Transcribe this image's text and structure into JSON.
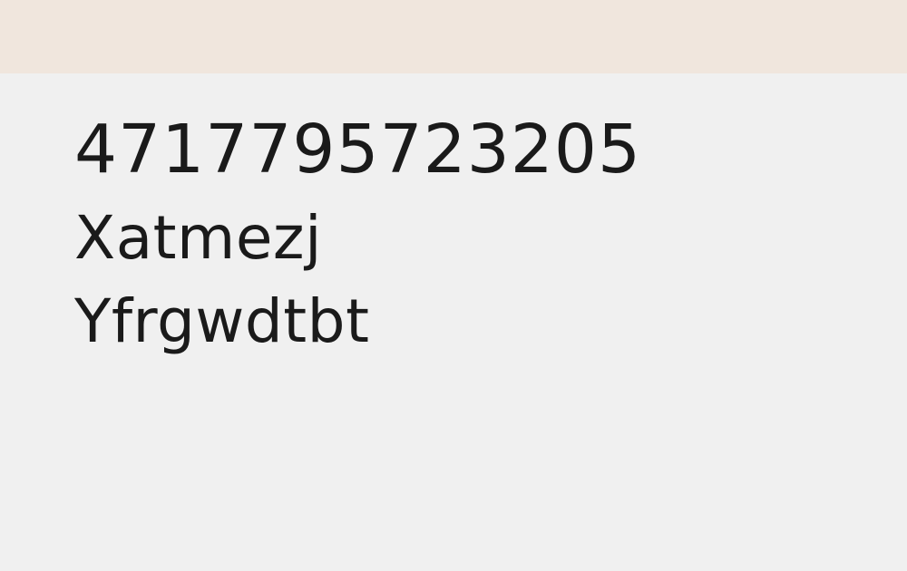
{
  "header": {
    "bar_color": "#f0e6dd"
  },
  "content": {
    "number": "4717795723205",
    "line1": "Xatmezj",
    "line2": "Yfrgwdtbt"
  },
  "colors": {
    "background": "#f0f0f0",
    "text": "#1a1a1a"
  }
}
